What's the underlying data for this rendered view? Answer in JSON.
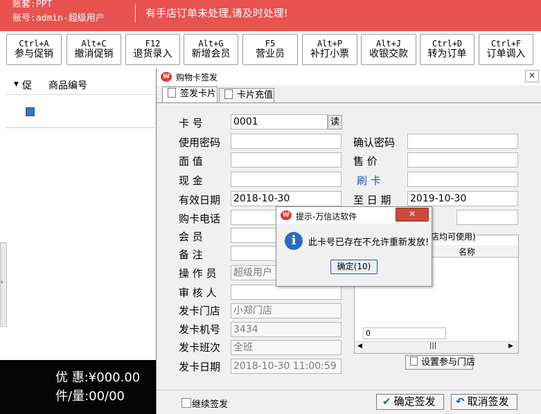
{
  "header": {
    "account_set": "账套:PPT",
    "account_user": "账号:admin-超级用户",
    "notice": "有手店订单未处理,请及时处理!"
  },
  "toolbar": [
    {
      "key": "Ctrl+A",
      "label": "参与促销"
    },
    {
      "key": "Alt+C",
      "label": "撤消促销"
    },
    {
      "key": "F12",
      "label": "退货录入"
    },
    {
      "key": "Alt+G",
      "label": "新增会员"
    },
    {
      "key": "F5",
      "label": "营业员"
    },
    {
      "key": "Alt+P",
      "label": "补打小票"
    },
    {
      "key": "Alt+J",
      "label": "收银交款"
    },
    {
      "key": "Ctrl+D",
      "label": "转为订单"
    },
    {
      "key": "Ctrl+F",
      "label": "订单调入"
    }
  ],
  "left_panel": {
    "col_promo": "促",
    "col_code": "商品编号"
  },
  "summary": {
    "discount": "优 惠:¥000.00",
    "count": "件/量:00/00"
  },
  "dialog": {
    "title": "购物卡签发",
    "tabs": [
      "签发卡片",
      "卡片充值"
    ],
    "labels": {
      "card_no": "卡 号",
      "password": "使用密码",
      "confirm_password": "确认密码",
      "face_value": "面 值",
      "price": "售 价",
      "cash": "现 金",
      "swipe": "刷 卡",
      "valid_date": "有效日期",
      "to_date": "至 日 期",
      "phone": "购卡电话",
      "member": "会 员",
      "remark": "备 注",
      "operator": "操 作 员",
      "auditor": "审 核 人",
      "store": "发卡门店",
      "machine": "发卡机号",
      "shift": "发卡班次",
      "issue_date": "发卡日期"
    },
    "values": {
      "card_no": "0001",
      "valid_date": "2018-10-30",
      "to_date": "2019-10-30",
      "operator": "超级用户",
      "store": "小郑门店",
      "machine": "3434",
      "shift": "全班",
      "issue_date": "2018-10-30 11:00:59"
    },
    "read_button": "读",
    "store_note": "店均可使用)",
    "store_col_name": "名称",
    "store_footer_value": "0",
    "set_store_button": "设置参与门店",
    "continue_label": "继续签发",
    "confirm_button": "确定签发",
    "cancel_button": "取消签发"
  },
  "alert": {
    "title": "提示-万信达软件",
    "message": "此卡号已存在不允许重新发放!",
    "ok_button": "确定(10)"
  },
  "colors": {
    "header_red": "#e8524f",
    "summary_bg": "#050505",
    "alert_close": "#c94b3c"
  }
}
